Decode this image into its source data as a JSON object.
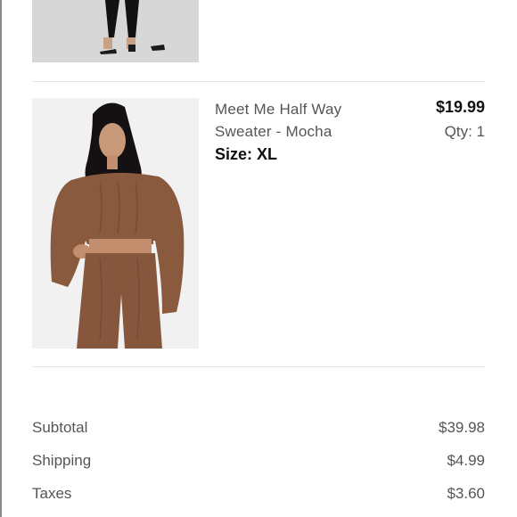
{
  "cart": {
    "item": {
      "name": "Meet Me Half Way Sweater - Mocha",
      "size_label": "Size: XL",
      "price": "$19.99",
      "qty": "Qty: 1",
      "color": "#8a5a3f"
    }
  },
  "totals": {
    "rows": [
      {
        "label": "Subtotal",
        "value": "$39.98"
      },
      {
        "label": "Shipping",
        "value": "$4.99"
      },
      {
        "label": "Taxes",
        "value": "$3.60"
      }
    ]
  }
}
